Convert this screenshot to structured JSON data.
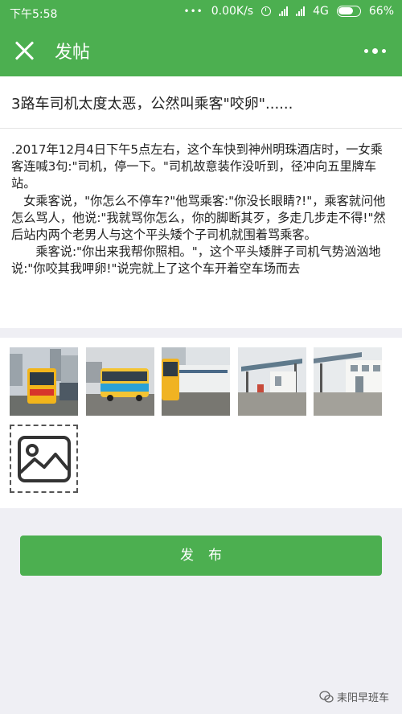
{
  "status_bar": {
    "time": "下午5:58",
    "network_speed": "0.00K/s",
    "network_type": "4G",
    "battery": "66%",
    "icons": [
      "dots-icon",
      "alarm-icon",
      "signal-icon",
      "signal-icon",
      "battery-icon"
    ]
  },
  "header": {
    "title": "发帖",
    "close_icon": "close-icon",
    "more_icon": "more-icon"
  },
  "post": {
    "title": "3路车司机太度太恶，公然叫乘客\"咬卵\"......",
    "body_paragraphs": [
      ".2017年12月4日下午5点左右，这个车快到神州明珠酒店时，一女乘客连喊3句:\"司机，停一下。\"司机故意装作没听到，径冲向五里牌车站。",
      "　女乘客说，\"你怎么不停车?\"他骂乘客:\"你没长眼睛?!\"，乘客就问他怎么骂人，他说:\"我就骂你怎么，你的脚断其歹，多走几步走不得!\"然后站内两个老男人与这个平头矮个子司机就围着骂乘客。",
      "　　乘客说:\"你出来我帮你照相。\"，这个平头矮胖子司机气势汹汹地说:\"你咬其我呷卵!\"说完就上了这个车开着空车场而去"
    ]
  },
  "images": {
    "count": 5,
    "add_icon": "add-image-icon"
  },
  "actions": {
    "publish_label": "发布"
  },
  "watermark": {
    "text": "耒阳早班车"
  },
  "colors": {
    "accent": "#4caf50",
    "background": "#efeff4"
  }
}
